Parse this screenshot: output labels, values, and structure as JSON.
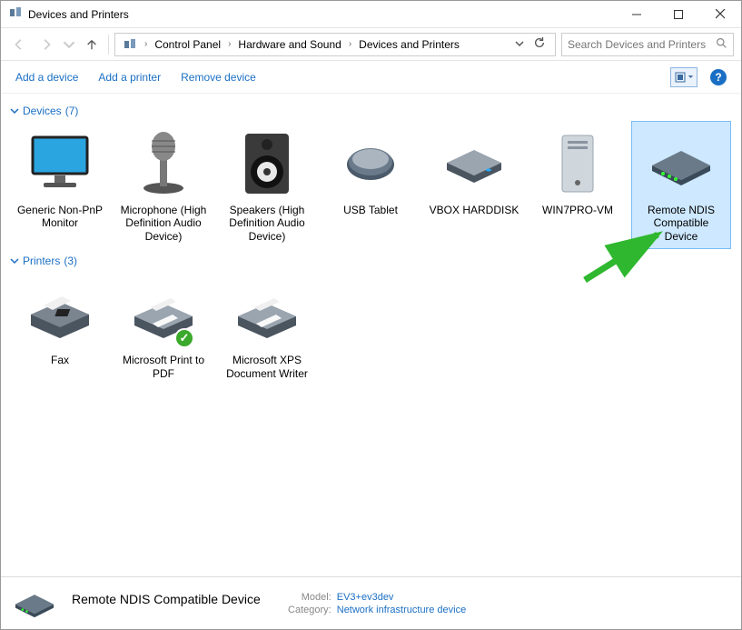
{
  "window": {
    "title": "Devices and Printers"
  },
  "breadcrumb": {
    "items": [
      "Control Panel",
      "Hardware and Sound",
      "Devices and Printers"
    ]
  },
  "search": {
    "placeholder": "Search Devices and Printers"
  },
  "commands": {
    "add_device": "Add a device",
    "add_printer": "Add a printer",
    "remove_device": "Remove device"
  },
  "groups": [
    {
      "name": "Devices",
      "count": 7,
      "items": [
        {
          "label": "Generic Non-PnP Monitor",
          "icon": "monitor",
          "selected": false
        },
        {
          "label": "Microphone (High Definition Audio Device)",
          "icon": "microphone",
          "selected": false
        },
        {
          "label": "Speakers (High Definition Audio Device)",
          "icon": "speaker",
          "selected": false
        },
        {
          "label": "USB Tablet",
          "icon": "mouse",
          "selected": false
        },
        {
          "label": "VBOX HARDDISK",
          "icon": "harddisk",
          "selected": false
        },
        {
          "label": "WIN7PRO-VM",
          "icon": "computer",
          "selected": false
        },
        {
          "label": "Remote NDIS Compatible Device",
          "icon": "network-device",
          "selected": true
        }
      ]
    },
    {
      "name": "Printers",
      "count": 3,
      "items": [
        {
          "label": "Fax",
          "icon": "fax",
          "selected": false
        },
        {
          "label": "Microsoft Print to PDF",
          "icon": "printer",
          "selected": false,
          "default": true
        },
        {
          "label": "Microsoft XPS Document Writer",
          "icon": "printer",
          "selected": false
        }
      ]
    }
  ],
  "details": {
    "name": "Remote NDIS Compatible Device",
    "props": [
      {
        "key": "Model:",
        "val": "EV3+ev3dev"
      },
      {
        "key": "Category:",
        "val": "Network infrastructure device"
      }
    ]
  },
  "icon_names": {
    "monitor": "monitor-icon",
    "microphone": "microphone-icon",
    "speaker": "speaker-icon",
    "mouse": "mouse-icon",
    "harddisk": "harddisk-icon",
    "computer": "computer-icon",
    "network-device": "network-device-icon",
    "fax": "fax-icon",
    "printer": "printer-icon"
  }
}
